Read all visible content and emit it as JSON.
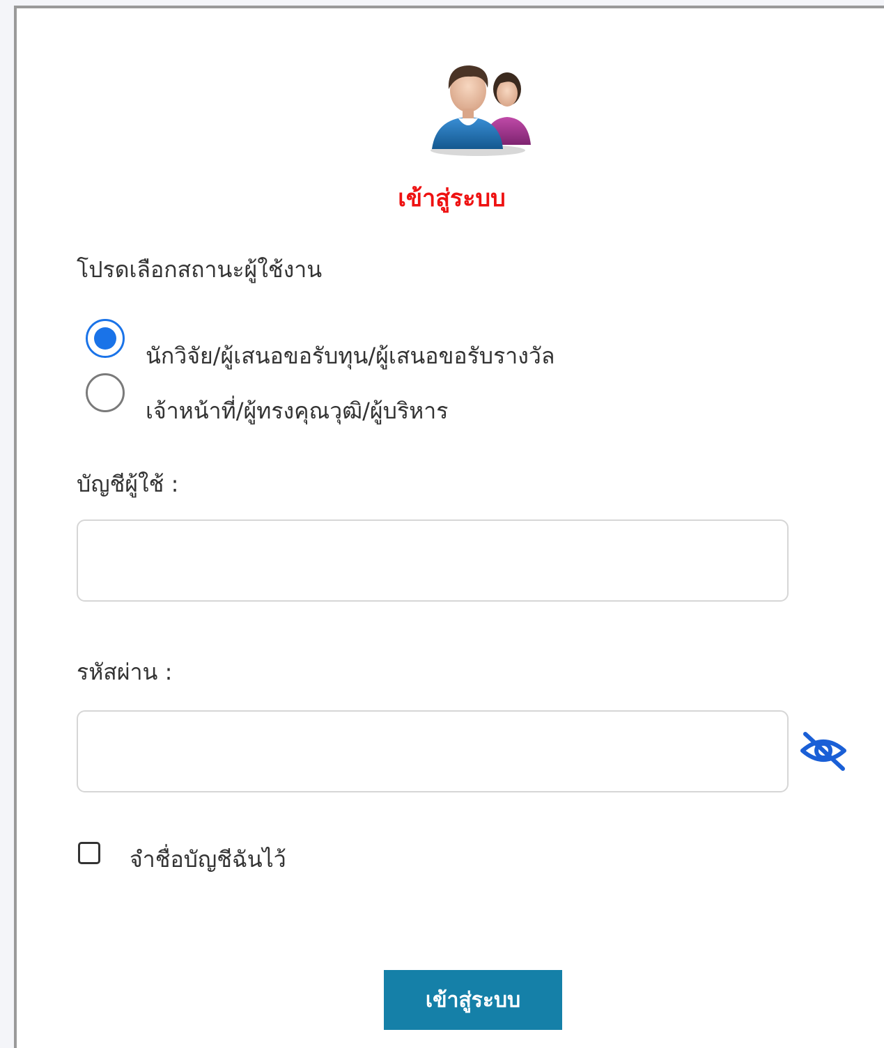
{
  "header": {
    "avatar_icon": "users-icon",
    "title": "เข้าสู่ระบบ"
  },
  "role_section": {
    "prompt": "โปรดเลือกสถานะผู้ใช้งาน",
    "options": [
      {
        "label": "นักวิจัย/ผู้เสนอขอรับทุน/ผู้เสนอขอรับรางวัล",
        "selected": true
      },
      {
        "label": "เจ้าหน้าที่/ผู้ทรงคุณวุฒิ/ผู้บริหาร",
        "selected": false
      }
    ]
  },
  "username": {
    "label": "บัญชีผู้ใช้ :",
    "value": ""
  },
  "password": {
    "label": "รหัสผ่าน :",
    "value": "",
    "toggle_icon": "eye-slash-icon"
  },
  "remember": {
    "label": "จำชื่อบัญชีฉันไว้",
    "checked": false
  },
  "submit": {
    "label": "เข้าสู่ระบบ"
  },
  "colors": {
    "title": "#ee1111",
    "accent": "#1a73e8",
    "button": "#1580a8"
  }
}
